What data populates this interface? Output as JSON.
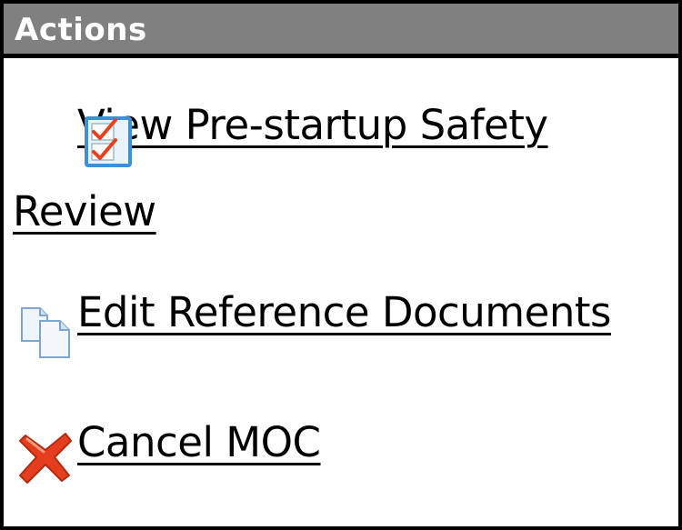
{
  "panel": {
    "title": "Actions"
  },
  "actions": [
    {
      "label": "View Pre-startup Safety Review",
      "icon": "checklist-icon"
    },
    {
      "label": "Edit Reference Documents",
      "icon": "documents-icon"
    },
    {
      "label": "Cancel MOC",
      "icon": "cancel-x-icon"
    }
  ],
  "colors": {
    "header_bg": "#808080",
    "header_text": "#ffffff",
    "border": "#000000",
    "checkmark": "#e8401c",
    "icon_blue": "#3d8fd6",
    "cancel_red": "#e53e1e"
  }
}
